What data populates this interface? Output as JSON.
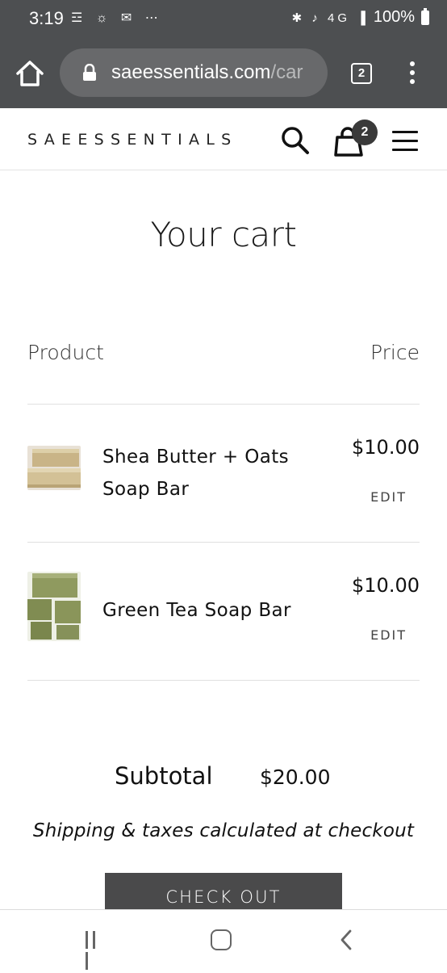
{
  "status_bar": {
    "time": "3:19",
    "left_icons": "☲ ☼ ✉ ⋯",
    "right_icons": "✱ ♪ 4G ▐",
    "battery": "100%"
  },
  "browser": {
    "url_host": "saeessentials.com",
    "url_path": "/car",
    "tab_count": "2"
  },
  "header": {
    "logo": "SAEESSENTIALS",
    "cart_count": "2"
  },
  "cart": {
    "title": "Your cart",
    "col_product": "Product",
    "col_price": "Price",
    "items": [
      {
        "name": "Shea Butter + Oats Soap Bar",
        "price": "$10.00",
        "edit": "EDIT"
      },
      {
        "name": "Green Tea Soap Bar",
        "price": "$10.00",
        "edit": "EDIT"
      }
    ],
    "subtotal_label": "Subtotal",
    "subtotal_value": "$20.00",
    "shipping_note": "Shipping & taxes calculated at checkout",
    "checkout_label": "CHECK OUT"
  },
  "colors": {
    "browser_chrome": "#4d4f51",
    "checkout_button": "#4a4a4b"
  }
}
